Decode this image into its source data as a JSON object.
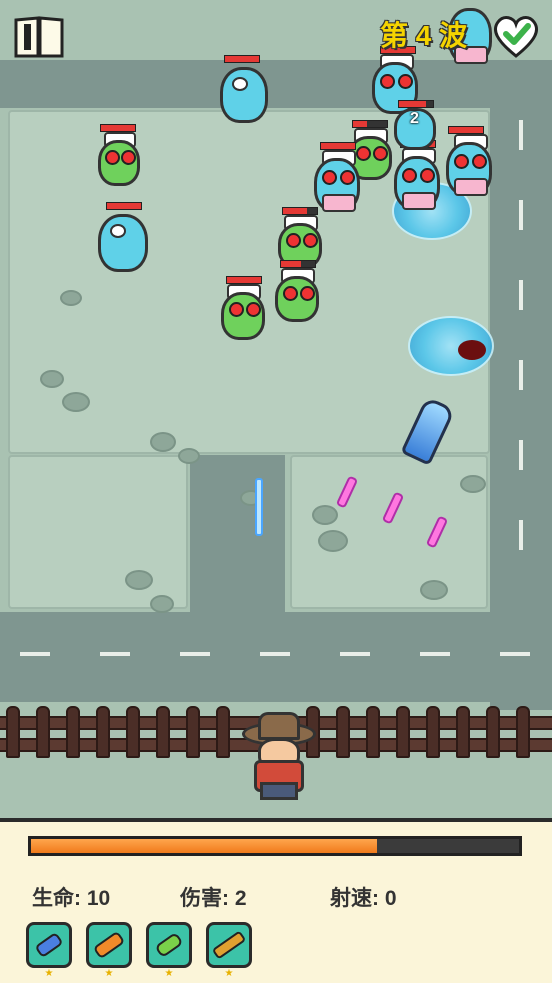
{
  "hud": {
    "wave_label": "第 4 波",
    "pause_icon": "book-pause-icon",
    "speed_icon": "heart-check-icon"
  },
  "stats": {
    "life": "生命: 10",
    "damage": "伤害: 2",
    "fire_rate": "射速: 0"
  },
  "wave_progress": 0.71,
  "floating_text": "2",
  "weapons": [
    {
      "icon": "blue-cannon-icon",
      "stars": "★"
    },
    {
      "icon": "orange-blaster-icon",
      "stars": "★"
    },
    {
      "icon": "green-raygun-icon",
      "stars": "★"
    },
    {
      "icon": "bazooka-icon",
      "stars": "★"
    }
  ],
  "colors": {
    "progress_fill": "#f07a1b",
    "panel_bg": "#fbf5d9",
    "weapon_slot": "#3cc3a8",
    "wave_text": "#f5d400"
  }
}
